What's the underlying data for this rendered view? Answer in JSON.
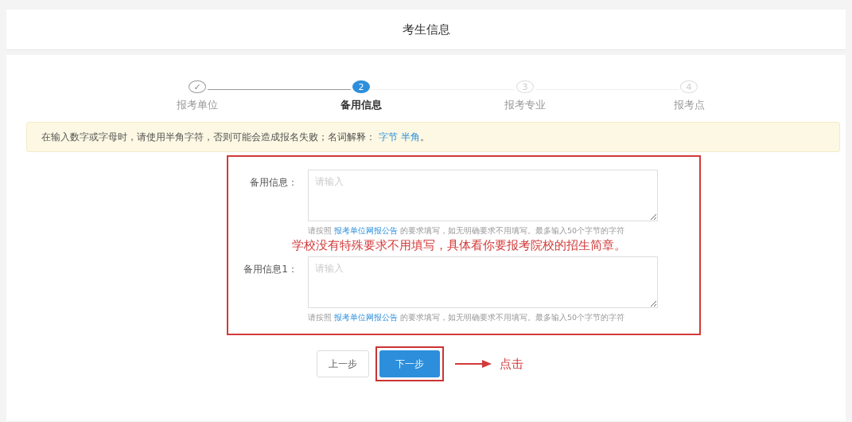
{
  "header": {
    "title": "考生信息"
  },
  "steps": [
    {
      "number": "✓",
      "label": "报考单位",
      "completed": true,
      "selected": false
    },
    {
      "number": "2",
      "label": "备用信息",
      "completed": false,
      "selected": true
    },
    {
      "number": "3",
      "label": "报考专业",
      "completed": false,
      "selected": false
    },
    {
      "number": "4",
      "label": "报考点",
      "completed": false,
      "selected": false
    }
  ],
  "notice": {
    "text": "在输入数字或字母时，请使用半角字符，否则可能会造成报名失败；名词解释：",
    "links": [
      "字节",
      "半角"
    ],
    "suffix": "。"
  },
  "fields": [
    {
      "label": "备用信息：",
      "placeholder": "请输入",
      "hint_prefix": "请按照",
      "hint_link": "报考单位网报公告",
      "hint_suffix": "的要求填写，如无明确要求不用填写。最多输入50个字节的字符"
    },
    {
      "label": "备用信息1：",
      "placeholder": "请输入",
      "hint_prefix": "请按照",
      "hint_link": "报考单位网报公告",
      "hint_suffix": "的要求填写，如无明确要求不用填写。最多输入50个字节的字符"
    }
  ],
  "annotation": "学校没有特殊要求不用填写，具体看你要报考院校的招生简章。",
  "buttons": [
    {
      "label": "上一步",
      "kind": "secondary"
    },
    {
      "label": "下一步",
      "kind": "primary"
    }
  ],
  "click_note": "点击"
}
